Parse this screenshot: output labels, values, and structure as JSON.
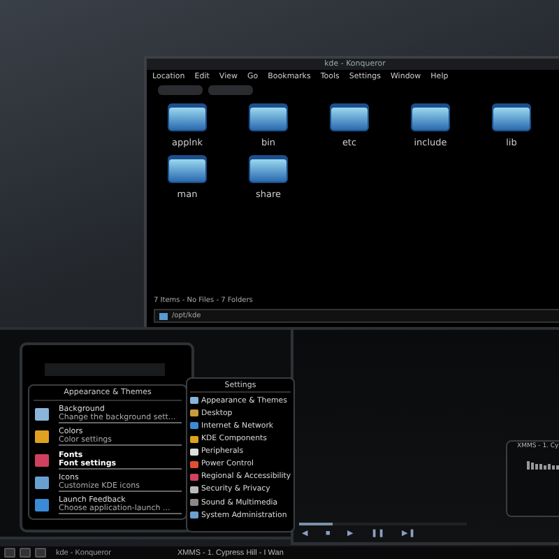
{
  "konqueror": {
    "title": "kde - Konqueror",
    "menu": [
      "Location",
      "Edit",
      "View",
      "Go",
      "Bookmarks",
      "Tools",
      "Settings",
      "Window",
      "Help"
    ],
    "files": [
      {
        "name": "applnk"
      },
      {
        "name": "bin"
      },
      {
        "name": "etc"
      },
      {
        "name": "include"
      },
      {
        "name": "lib"
      },
      {
        "name": "man"
      },
      {
        "name": "share"
      }
    ],
    "status": "7 Items - No Files - 7 Folders",
    "location": "/opt/kde"
  },
  "control_center": {
    "title": "Appearance & Themes",
    "items": [
      {
        "label": "Background",
        "description": "Change the background sett...",
        "selected": false
      },
      {
        "label": "Colors",
        "description": "Color settings",
        "selected": false
      },
      {
        "label": "Fonts",
        "description": "Font settings",
        "selected": true
      },
      {
        "label": "Icons",
        "description": "Customize KDE icons",
        "selected": false
      },
      {
        "label": "Launch Feedback",
        "description": "Choose application-launch ...",
        "selected": false
      }
    ]
  },
  "settings_menu": {
    "title": "Settings",
    "items": [
      "Appearance & Themes",
      "Desktop",
      "Internet & Network",
      "KDE Components",
      "Peripherals",
      "Power Control",
      "Regional & Accessibility",
      "Security & Privacy",
      "Sound & Multimedia",
      "System Administration"
    ]
  },
  "media_player": {
    "controls": [
      "◀",
      "■",
      "▶",
      "❚❚",
      "▶❚"
    ],
    "level": 0.2
  },
  "xmms_mini": {
    "title": "XMMS - 1. Cy"
  },
  "taskbar": {
    "tasks": [
      "kde - Konqueror",
      "XMMS - 1. Cypress Hill - I Wan"
    ]
  }
}
